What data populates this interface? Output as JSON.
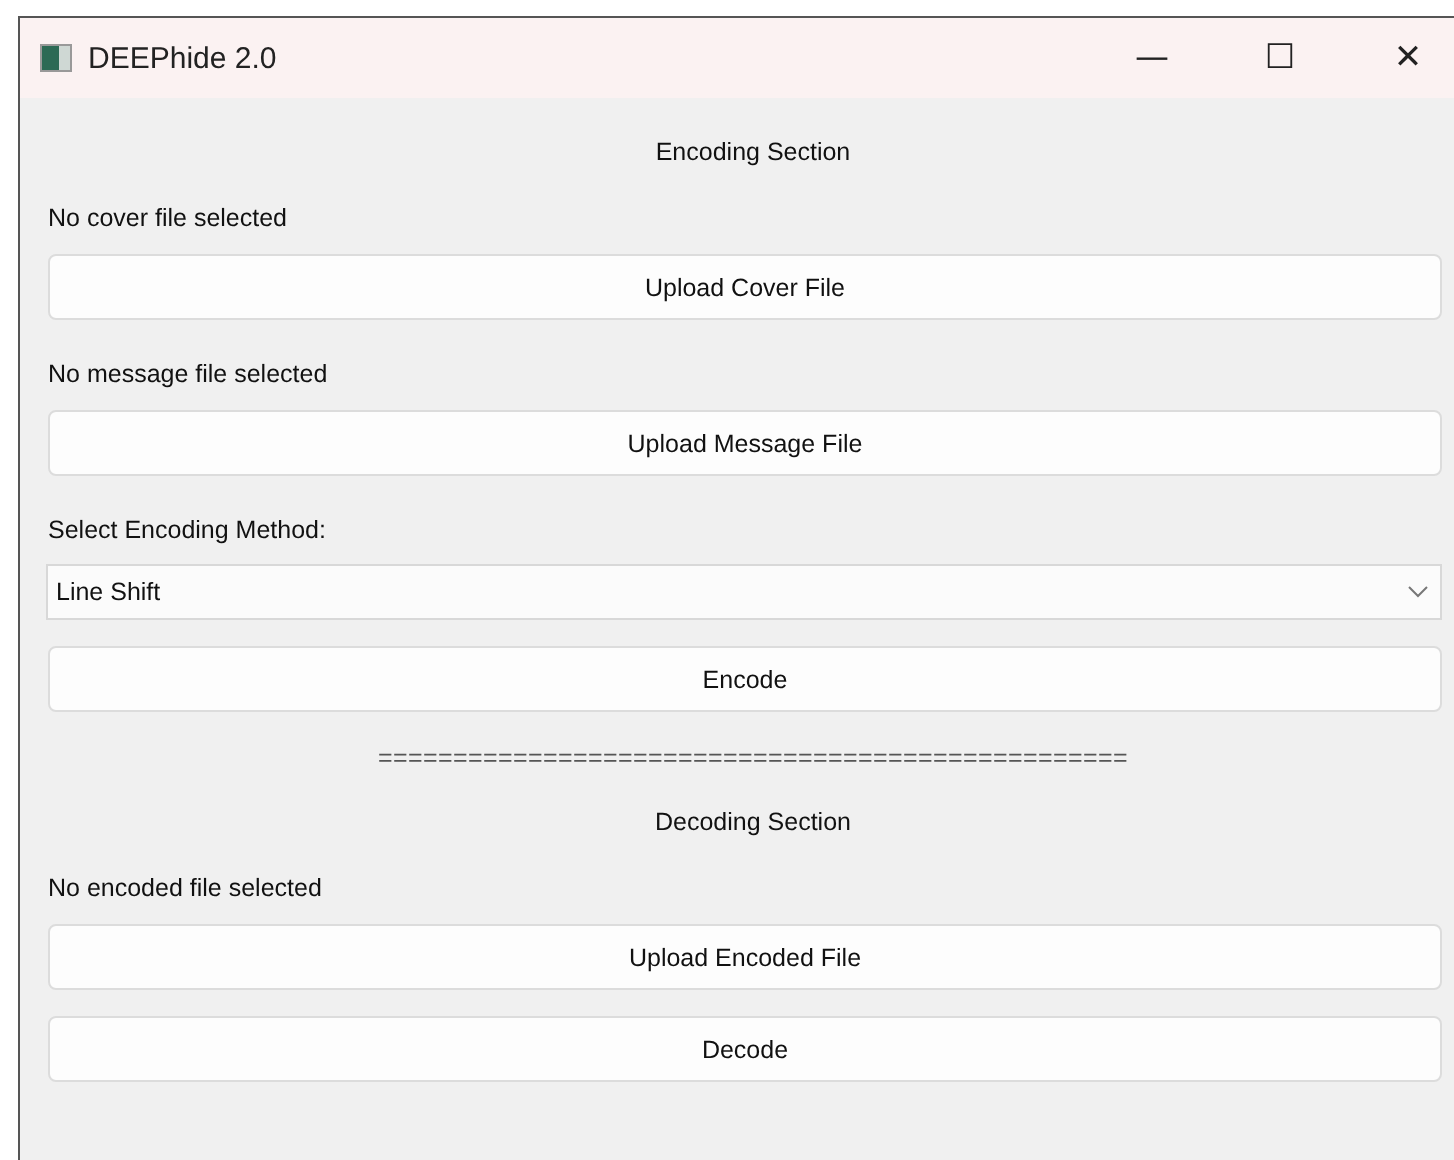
{
  "window": {
    "title": "DEEPhide 2.0",
    "controls": [
      "—",
      "☐",
      "✕"
    ]
  },
  "items": [
    {
      "kind": "heading",
      "text": "Encoding Section"
    },
    {
      "kind": "label",
      "text": "No cover file selected"
    },
    {
      "kind": "button",
      "text": "Upload Cover File"
    },
    {
      "kind": "label",
      "text": "No message file selected"
    },
    {
      "kind": "button",
      "text": "Upload Message File"
    },
    {
      "kind": "label",
      "text": "Select Encoding Method:"
    },
    {
      "kind": "combo",
      "text": "Line Shift"
    },
    {
      "kind": "button",
      "text": "Encode"
    },
    {
      "kind": "separator",
      "text": "=================================================="
    },
    {
      "kind": "heading",
      "text": "Decoding Section"
    },
    {
      "kind": "label",
      "text": "No encoded file selected"
    },
    {
      "kind": "button",
      "text": "Upload Encoded File"
    },
    {
      "kind": "button",
      "text": "Decode"
    }
  ]
}
